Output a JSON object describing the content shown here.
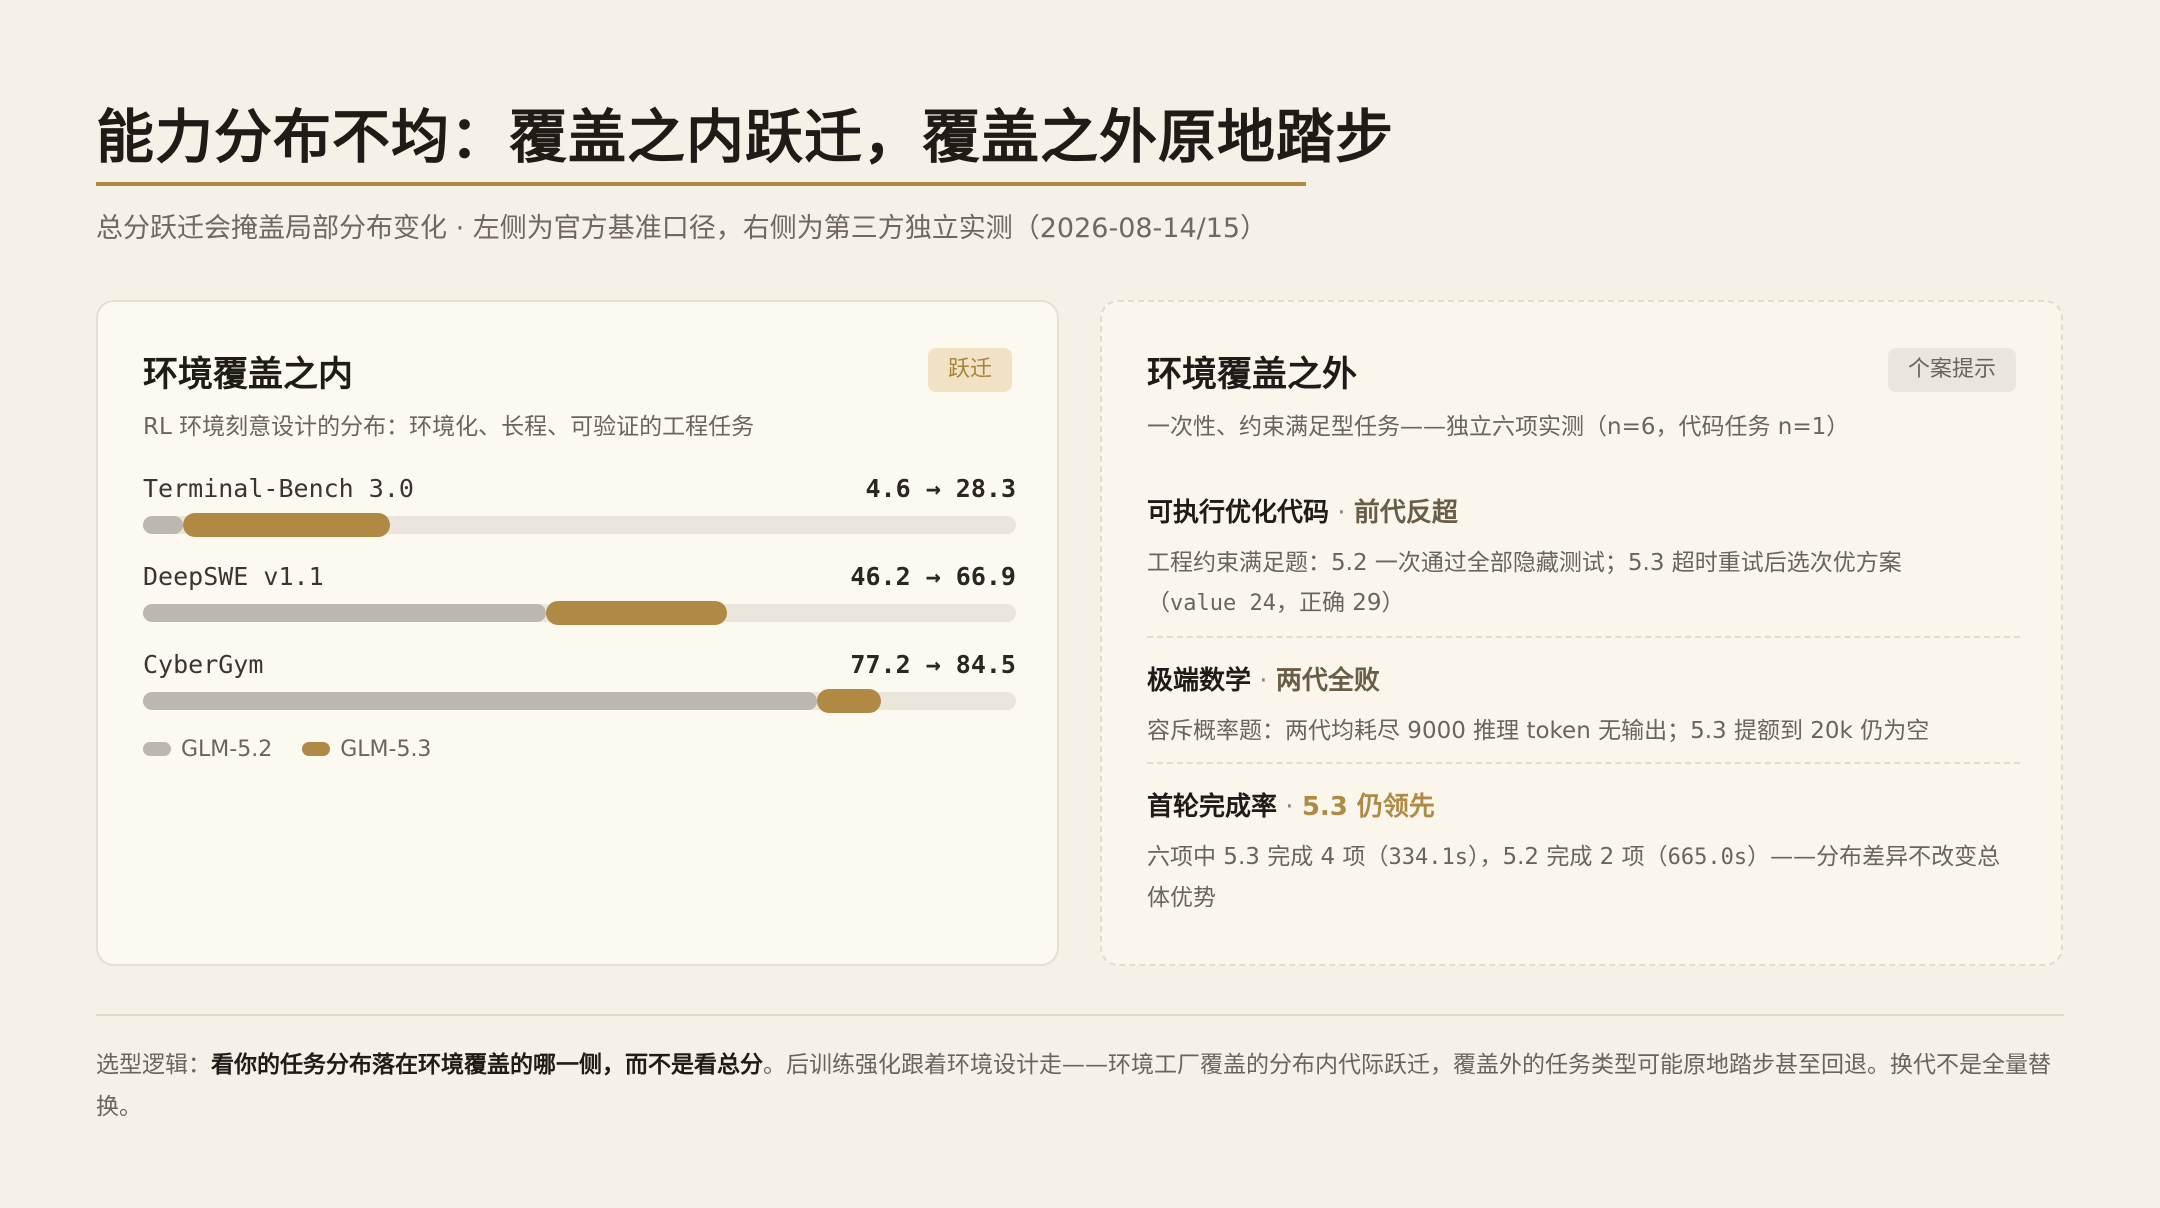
{
  "header": {
    "title": "能力分布不均：覆盖之内跃迁，覆盖之外原地踏步",
    "subtitle": "总分跃迁会掩盖局部分布变化 · 左侧为官方基准口径，右侧为第三方独立实测（2026-08-14/15）"
  },
  "left_card": {
    "title": "环境覆盖之内",
    "badge": "跃迁",
    "description": "RL 环境刻意设计的分布：环境化、长程、可验证的工程任务",
    "metrics": [
      {
        "name": "Terminal-Bench 3.0",
        "value_text": "4.6 → 28.3",
        "old": 4.6,
        "new": 28.3
      },
      {
        "name": "DeepSWE v1.1",
        "value_text": "46.2 → 66.9",
        "old": 46.2,
        "new": 66.9
      },
      {
        "name": "CyberGym",
        "value_text": "77.2 → 84.5",
        "old": 77.2,
        "new": 84.5
      }
    ],
    "legend": {
      "old_label": "GLM-5.2",
      "new_label": "GLM-5.3"
    },
    "colors": {
      "old": "#bdb8ad",
      "new": "#b08a45",
      "track": "#ebe6dc"
    }
  },
  "right_card": {
    "title": "环境覆盖之外",
    "badge": "个案提示",
    "description": "一次性、约束满足型任务——独立六项实测（n=6，代码任务 n=1）",
    "cases": [
      {
        "title": "可执行优化代码",
        "sep": " · ",
        "tag": "前代反超",
        "body_a": "工程约束满足题：5.2 一次通过全部隐藏测试；5.3 超时重试后选次优方案",
        "body_b": "（",
        "body_mono": "value 24",
        "body_c": "，正确 29）"
      },
      {
        "title": "极端数学",
        "sep": " · ",
        "tag": "两代全败",
        "body": "容斥概率题：两代均耗尽 9000 推理 token 无输出；5.3 提额到 20k 仍为空"
      },
      {
        "title": "首轮完成率",
        "sep": " · ",
        "tag": "5.3 仍领先",
        "body_a": "六项中 5.3 完成 4 项（",
        "body_mono1": "334.1s",
        "body_b": "），5.2 完成 2 项（",
        "body_mono2": "665.0s",
        "body_c": "）——分布差异不改变总体优势"
      }
    ]
  },
  "footer": {
    "prefix": "选型逻辑：",
    "bold": "看你的任务分布落在环境覆盖的哪一侧，而不是看总分",
    "rest": "。后训练强化跟着环境设计走——环境工厂覆盖的分布内代际跃迁，覆盖外的任务类型可能原地踏步甚至回退。换代不是全量替换。"
  }
}
